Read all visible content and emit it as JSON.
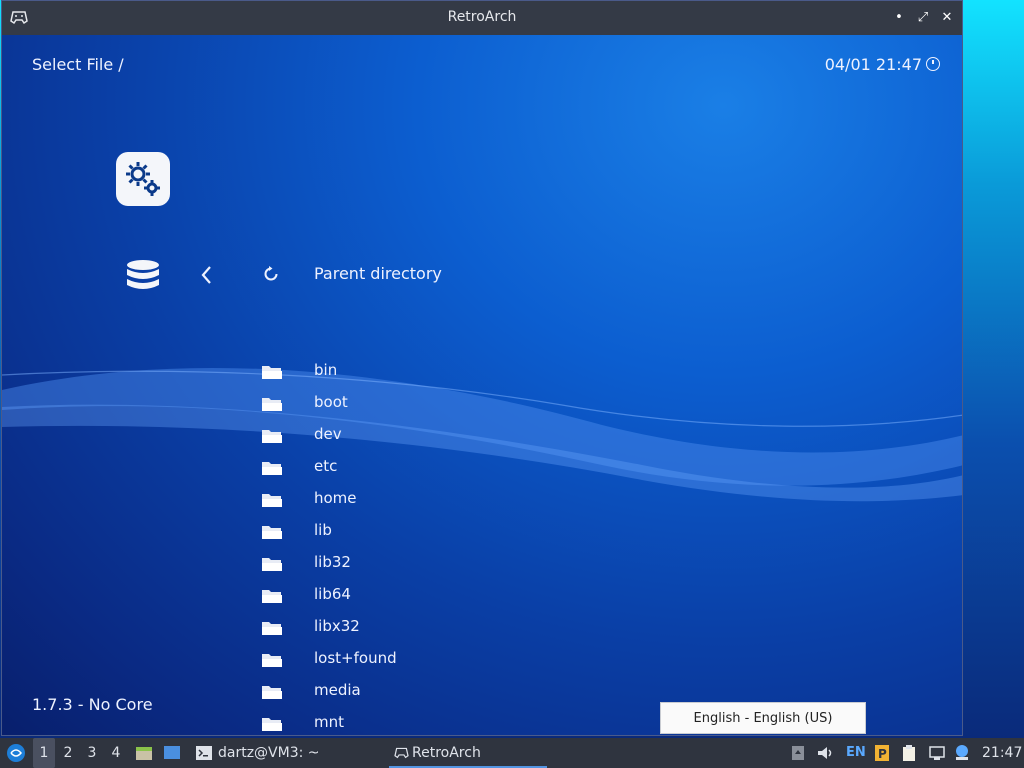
{
  "window": {
    "title": "RetroArch",
    "controls": {
      "minimize": "•",
      "maximize": "⤢",
      "close": "✕"
    }
  },
  "header": {
    "location": "Select File /",
    "datetime": "04/01 21:47"
  },
  "menu": {
    "parent_label": "Parent directory",
    "files": [
      "bin",
      "boot",
      "dev",
      "etc",
      "home",
      "lib",
      "lib32",
      "lib64",
      "libx32",
      "lost+found",
      "media",
      "mnt"
    ],
    "version": "1.7.3 - No Core"
  },
  "language_popup": "English - English (US)",
  "taskbar": {
    "workspaces": [
      "1",
      "2",
      "3",
      "4"
    ],
    "active_workspace": "1",
    "terminal_task": "dartz@VM3: ~",
    "retroarch_task": "RetroArch",
    "keyboard_layout": "EN",
    "clock": "21:47"
  },
  "colors": {
    "titlebar": "#343a46",
    "taskbar": "#2f343f",
    "content_blue": "#0c5ed0",
    "accent": "#5294e2"
  },
  "icons": [
    "gamepad-icon",
    "gear-icon",
    "database-icon",
    "chevron-left-icon",
    "refresh-icon",
    "folder-icon",
    "clock-icon",
    "start-menu-icon",
    "file-manager-icon",
    "terminal-icon",
    "volume-icon",
    "clipboard-icon",
    "network-icon"
  ]
}
